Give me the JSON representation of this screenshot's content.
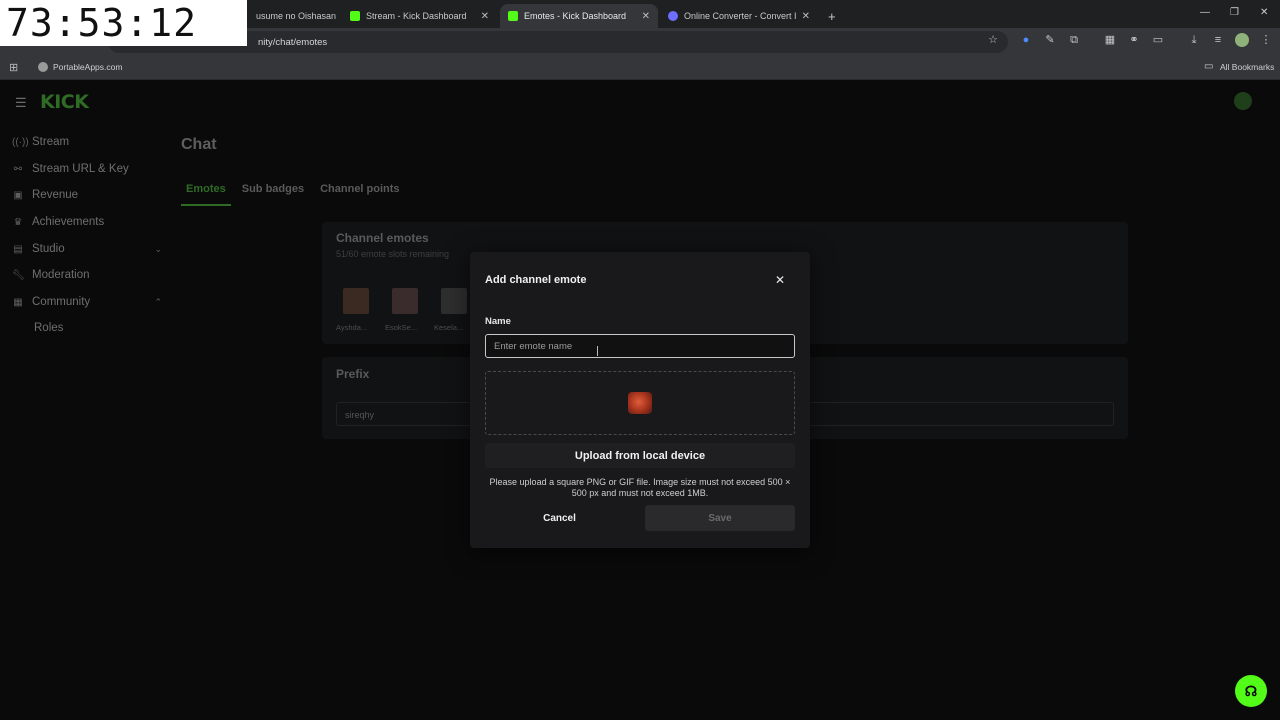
{
  "timer": "73:53:12",
  "browser": {
    "tabs": [
      {
        "title": "usume no Oishasan",
        "active": false,
        "fav_color": "#ff0000"
      },
      {
        "title": "Stream - Kick Dashboard",
        "active": false,
        "fav_color": "#53fc18"
      },
      {
        "title": "Emotes - Kick Dashboard",
        "active": true,
        "fav_color": "#53fc18"
      },
      {
        "title": "Online Converter - Convert Ima",
        "active": false,
        "fav_color": "#6d6dff"
      }
    ],
    "new_tab": "+",
    "url": "nity/chat/emotes",
    "bookmarks": {
      "item": "PortableApps.com",
      "all": "All Bookmarks"
    }
  },
  "sidebar": {
    "items": [
      {
        "label": "Stream",
        "icon": "broadcast-icon"
      },
      {
        "label": "Stream URL & Key",
        "icon": "link-icon"
      },
      {
        "label": "Revenue",
        "icon": "revenue-icon"
      },
      {
        "label": "Achievements",
        "icon": "trophy-icon"
      },
      {
        "label": "Studio",
        "icon": "studio-icon",
        "chevron": "down"
      },
      {
        "label": "Moderation",
        "icon": "wrench-icon"
      },
      {
        "label": "Community",
        "icon": "community-icon",
        "chevron": "up"
      },
      {
        "label": "Roles",
        "icon": ""
      }
    ]
  },
  "page": {
    "title": "Chat",
    "tabs": [
      "Emotes",
      "Sub badges",
      "Channel points"
    ],
    "channel_emotes": {
      "title": "Channel emotes",
      "subtitle": "51/60 emote slots remaining",
      "emotes": [
        "Ayshda...",
        "EsokSe...",
        "Kesela..."
      ]
    },
    "prefix": {
      "title": "Prefix",
      "value": "sireqhy"
    }
  },
  "modal": {
    "title": "Add channel emote",
    "name_label": "Name",
    "name_placeholder": "Enter emote name",
    "name_value": "",
    "upload_label": "Upload from local device",
    "hint": "Please upload a square PNG or GIF file. Image size must not exceed 500 × 500 px and must not exceed 1MB.",
    "cancel_label": "Cancel",
    "save_label": "Save"
  },
  "logo_text": "KICK",
  "colors": {
    "accent": "#53fc18"
  }
}
